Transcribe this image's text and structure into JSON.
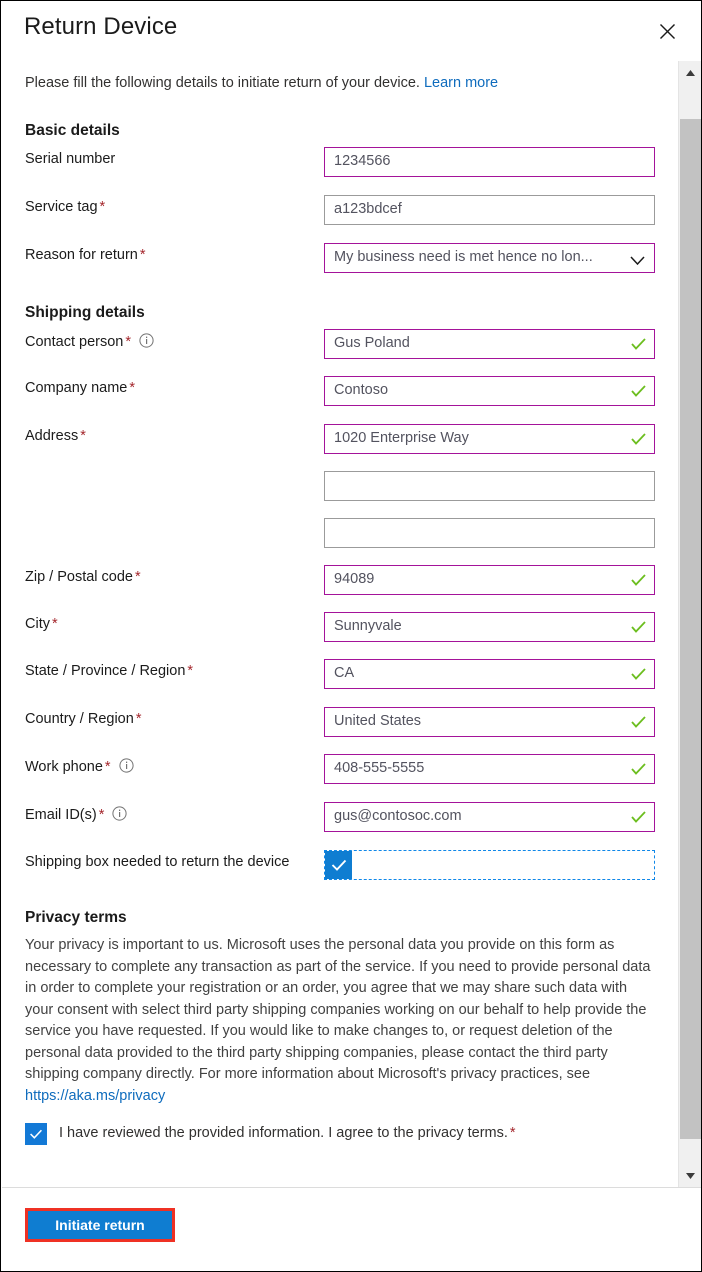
{
  "header": {
    "title": "Return Device",
    "close_icon": "close-icon"
  },
  "intro": {
    "text": "Please fill the following details to initiate return of your device.",
    "link_label": "Learn more"
  },
  "sections": {
    "basic": {
      "title": "Basic details",
      "fields": [
        {
          "label": "Serial number",
          "required": false,
          "info": false,
          "value": "1234566",
          "state": "validated",
          "check": false,
          "type": "text"
        },
        {
          "label": "Service tag",
          "required": true,
          "info": false,
          "value": "a123bdcef",
          "state": "normal",
          "check": false,
          "type": "text"
        },
        {
          "label": "Reason for return",
          "required": true,
          "info": false,
          "value": "My business need is met hence no lon...",
          "state": "validated",
          "check": false,
          "type": "dropdown"
        }
      ]
    },
    "shipping": {
      "title": "Shipping details",
      "fields": [
        {
          "label": "Contact person",
          "required": true,
          "info": true,
          "value": "Gus Poland",
          "state": "validated",
          "check": true,
          "type": "text"
        },
        {
          "label": "Company name",
          "required": true,
          "info": false,
          "value": "Contoso",
          "state": "validated",
          "check": true,
          "type": "text"
        },
        {
          "label": "Address",
          "required": true,
          "info": false,
          "value": "1020 Enterprise Way",
          "state": "validated",
          "check": true,
          "type": "text"
        },
        {
          "label": "",
          "required": false,
          "info": false,
          "value": "",
          "state": "normal",
          "check": false,
          "type": "text"
        },
        {
          "label": "",
          "required": false,
          "info": false,
          "value": "",
          "state": "normal",
          "check": false,
          "type": "text"
        },
        {
          "label": "Zip / Postal code",
          "required": true,
          "info": false,
          "value": "94089",
          "state": "validated",
          "check": true,
          "type": "text"
        },
        {
          "label": "City",
          "required": true,
          "info": false,
          "value": "Sunnyvale",
          "state": "validated",
          "check": true,
          "type": "text"
        },
        {
          "label": "State / Province / Region",
          "required": true,
          "info": false,
          "value": "CA",
          "state": "validated",
          "check": true,
          "type": "text"
        },
        {
          "label": "Country / Region",
          "required": true,
          "info": false,
          "value": "United States",
          "state": "validated",
          "check": true,
          "type": "text"
        },
        {
          "label": "Work phone",
          "required": true,
          "info": true,
          "value": "408-555-5555",
          "state": "validated",
          "check": true,
          "type": "text"
        },
        {
          "label": "Email ID(s)",
          "required": true,
          "info": true,
          "value": "gus@contosoc.com",
          "state": "validated",
          "check": true,
          "type": "text"
        }
      ],
      "shipping_box": {
        "label": "Shipping box needed to return the device",
        "checked": true
      }
    },
    "privacy": {
      "title": "Privacy terms",
      "body": "Your privacy is important to us. Microsoft uses the personal data you provide on this form as necessary to complete any transaction as part of the service. If you need to provide personal data in order to complete your registration or an order, you agree that we may share such data with your consent with select third party shipping companies working on our behalf to help provide the service you have requested. If you would like to make changes to, or request deletion of the personal data provided to the third party shipping companies, please contact the third party shipping company directly. For more information about Microsoft's privacy practices, see ",
      "link_label": "https://aka.ms/privacy",
      "agree_label": "I have reviewed the provided information. I agree to the privacy terms.",
      "agree_checked": true,
      "agree_required": true
    }
  },
  "footer": {
    "submit_label": "Initiate return"
  },
  "scrollbar": {
    "up_icon": "chevron-up-icon",
    "down_icon": "chevron-down-icon"
  },
  "colors": {
    "accent": "#0f7dd1",
    "validated_border": "#a4139a",
    "normal_border": "#9b9b9b",
    "check_green": "#6cbe1f",
    "required_red": "#a4262c",
    "link": "#0f6cbd",
    "highlight_red": "#ef3124"
  }
}
